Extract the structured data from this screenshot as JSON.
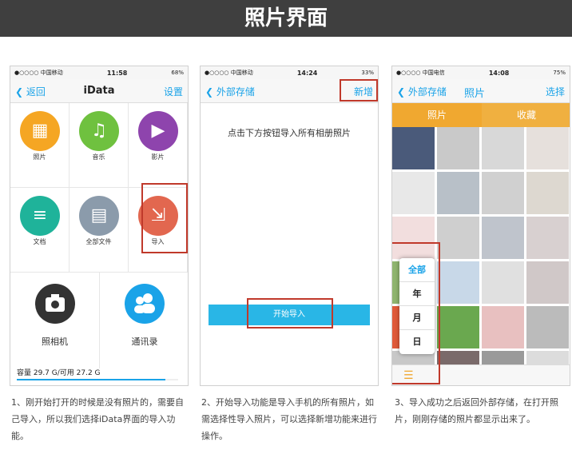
{
  "banner": {
    "title": "照片界面"
  },
  "phone1": {
    "status": {
      "carrier": "●○○○○ 中国移动",
      "time": "11:58",
      "battery": "68%"
    },
    "nav": {
      "back": "返回",
      "title": "iData",
      "settings": "设置"
    },
    "items": [
      {
        "label": "照片",
        "color": "#f5a623"
      },
      {
        "label": "音乐",
        "color": "#6fc13f"
      },
      {
        "label": "影片",
        "color": "#8e44ad"
      },
      {
        "label": "文档",
        "color": "#1fb39a"
      },
      {
        "label": "全部文件",
        "color": "#8b9bab"
      },
      {
        "label": "导入",
        "color": "#e2674f"
      }
    ],
    "big_items": [
      {
        "label": "照相机",
        "color": "#333333"
      },
      {
        "label": "通讯录",
        "color": "#1aa3e8"
      }
    ],
    "storage": "容量 29.7 G/可用 27.2 G",
    "storage_fraction": 0.92
  },
  "phone2": {
    "status": {
      "carrier": "●○○○○ 中国移动",
      "time": "14:24",
      "battery": "33%"
    },
    "nav": {
      "back": "外部存储",
      "right": "新增"
    },
    "text": "点击下方按钮导入所有相册照片",
    "button": "开始导入"
  },
  "phone3": {
    "status": {
      "carrier": "●○○○○ 中国电信",
      "time": "14:08",
      "battery": "75%"
    },
    "nav": {
      "back": "外部存储",
      "title": "照片",
      "right": "选择"
    },
    "tabs": [
      "照片",
      "收藏"
    ],
    "popup": [
      "全部",
      "年",
      "月",
      "日"
    ]
  },
  "captions": [
    "1、刚开始打开的时候是没有照片的，需要自己导入，所以我们选择iData界面的导入功能。",
    "2、开始导入功能是导入手机的所有照片，如需选择性导入照片，可以选择新增功能来进行操作。",
    "3、导入成功之后返回外部存储，在打开照片，刚刚存储的照片都显示出来了。"
  ],
  "colors": {
    "accent": "#1aa3e8",
    "highlight": "#c0392b",
    "tab_bg": "#f0a830"
  }
}
